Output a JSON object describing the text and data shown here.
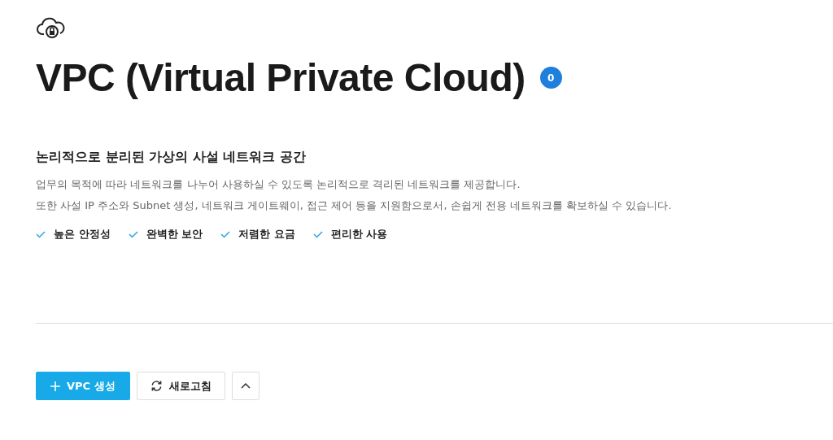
{
  "header": {
    "title": "VPC (Virtual Private Cloud)",
    "count": "0"
  },
  "intro": {
    "heading": "논리적으로 분리된 가상의 사설 네트워크 공간",
    "lines": [
      "업무의 목적에 따라 네트워크를 나누어 사용하실 수 있도록 논리적으로 격리된 네트워크를 제공합니다.",
      "또한 사설 IP 주소와 Subnet 생성, 네트워크 게이트웨이, 접근 제어 등을 지원함으로서, 손쉽게 전용 네트워크를 확보하실 수 있습니다."
    ],
    "features": [
      "높은 안정성",
      "완벽한 보안",
      "저렴한 요금",
      "편리한 사용"
    ]
  },
  "actions": {
    "create": "VPC 생성",
    "refresh": "새로고침"
  }
}
